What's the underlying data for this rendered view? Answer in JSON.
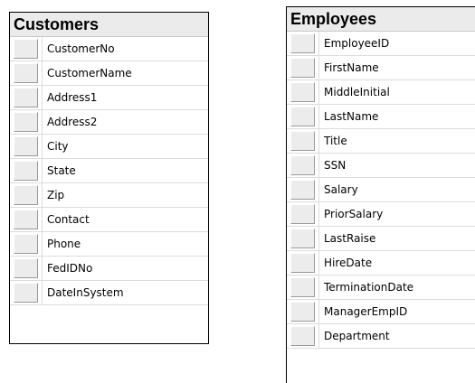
{
  "tables": [
    {
      "title": "Customers",
      "columns": [
        "CustomerNo",
        "CustomerName",
        "Address1",
        "Address2",
        "City",
        "State",
        "Zip",
        "Contact",
        "Phone",
        "FedIDNo",
        "DateInSystem"
      ]
    },
    {
      "title": "Employees",
      "columns": [
        "EmployeeID",
        "FirstName",
        "MiddleInitial",
        "LastName",
        "Title",
        "SSN",
        "Salary",
        "PriorSalary",
        "LastRaise",
        "HireDate",
        "TerminationDate",
        "ManagerEmpID",
        "Department"
      ]
    }
  ]
}
